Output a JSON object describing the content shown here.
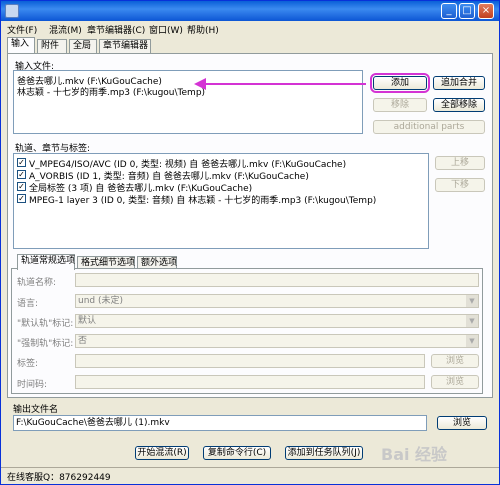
{
  "menu": [
    "文件(F)",
    "混流(M)",
    "章节编辑器(C)",
    "窗口(W)",
    "帮助(H)"
  ],
  "main_tabs": [
    "输入",
    "附件",
    "全局",
    "章节编辑器"
  ],
  "input_files": {
    "label": "输入文件:",
    "items": [
      "爸爸去哪儿.mkv (F:\\KuGouCache)",
      "林志颖 - 十七岁的雨季.mp3 (F:\\kugou\\Temp)"
    ]
  },
  "file_buttons": {
    "add": "添加",
    "append": "追加合并",
    "remove": "移除",
    "remove_all": "全部移除",
    "additional_parts": "additional parts"
  },
  "tracks": {
    "label": "轨道、章节与标签:",
    "items": [
      "V_MPEG4/ISO/AVC (ID 0, 类型: 视频) 自 爸爸去哪儿.mkv (F:\\KuGouCache)",
      "A_VORBIS (ID 1, 类型: 音频) 自 爸爸去哪儿.mkv (F:\\KuGouCache)",
      "全局标签 (3 项) 自 爸爸去哪儿.mkv (F:\\KuGouCache)",
      "MPEG-1 layer 3 (ID 0, 类型: 音频) 自 林志颖 - 十七岁的雨季.mp3 (F:\\kugou\\Temp)"
    ],
    "up": "上移",
    "down": "下移"
  },
  "sub_tabs": [
    "轨道常规选项",
    "格式细节选项",
    "额外选项"
  ],
  "options": {
    "track_name": "轨道名称:",
    "language": "语言:",
    "language_value": "und (未定)",
    "default_flag": "\"默认轨\"标记:",
    "default_value": "默认",
    "forced_flag": "\"强制轨\"标记:",
    "forced_value": "否",
    "tags": "标签:",
    "timecodes": "时间码:",
    "browse": "浏览"
  },
  "output": {
    "label": "输出文件名",
    "value": "F:\\KuGouCache\\爸爸去哪儿 (1).mkv",
    "browse": "浏览"
  },
  "actions": {
    "start": "开始混流(R)",
    "copy": "复制命令行(C)",
    "queue": "添加到任务队列(J)"
  },
  "status": "在线客服Q：876292449",
  "watermark": "Bai 经验",
  "accent": "#d433d4"
}
